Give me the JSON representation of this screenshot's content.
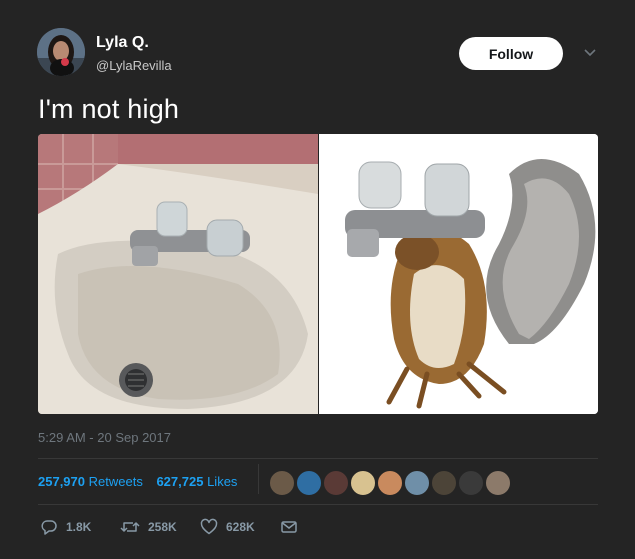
{
  "user": {
    "name": "Lyla Q.",
    "handle": "@LylaRevilla"
  },
  "follow_label": "Follow",
  "tweet": {
    "text": "I'm not high",
    "timestamp": "5:29 AM - 20 Sep 2017"
  },
  "stats": {
    "retweets_count": "257,970",
    "retweets_label": "Retweets",
    "likes_count": "627,725",
    "likes_label": "Likes"
  },
  "actions": {
    "replies": "1.8K",
    "retweets": "258K",
    "likes": "628K"
  },
  "colors": {
    "background": "#242424",
    "accent": "#1da1f2",
    "muted": "#6e767d"
  },
  "icons": [
    "caret-down-icon",
    "reply-icon",
    "retweet-icon",
    "heart-icon",
    "envelope-icon"
  ]
}
